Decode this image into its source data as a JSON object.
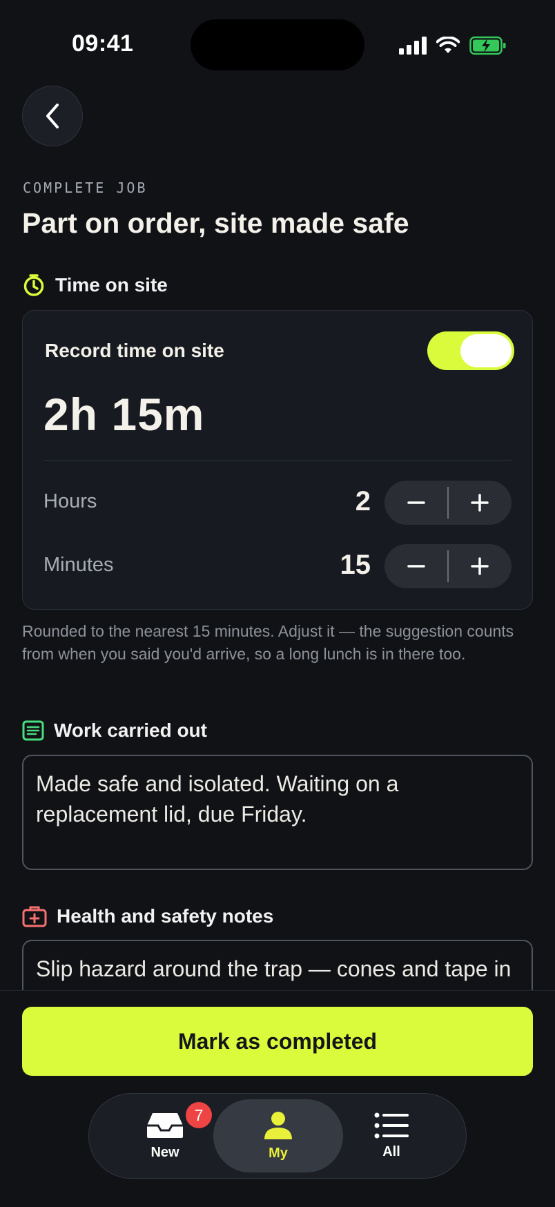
{
  "status_bar": {
    "time": "09:41"
  },
  "header": {
    "back_icon": "chevron-left-icon",
    "eyebrow": "COMPLETE JOB",
    "title": "Part on order, site made safe"
  },
  "time_on_site": {
    "section_label": "Time on site",
    "icon": "timer-icon",
    "record_label": "Record time on site",
    "record_enabled": true,
    "total": "2h 15m",
    "hours": {
      "label": "Hours",
      "value": "2"
    },
    "minutes": {
      "label": "Minutes",
      "value": "15"
    },
    "helper": "Rounded to the nearest 15 minutes. Adjust it — the suggestion counts from when you said you'd arrive, so a long lunch is in there too."
  },
  "work_carried_out": {
    "section_label": "Work carried out",
    "icon": "notes-icon",
    "value": "Made safe and isolated. Waiting on a replacement lid, due Friday."
  },
  "health_safety": {
    "section_label": "Health and safety notes",
    "icon": "first-aid-icon",
    "value": "Slip hazard around the trap — cones and tape in place."
  },
  "primary_action": {
    "label": "Mark as completed"
  },
  "tab_bar": {
    "tabs": [
      {
        "label": "New",
        "icon": "inbox-icon",
        "badge": "7"
      },
      {
        "label": "My",
        "icon": "person-icon",
        "active": true
      },
      {
        "label": "All",
        "icon": "list-icon"
      }
    ]
  },
  "colors": {
    "background": "#101216",
    "accent": "#d9fb3b",
    "badge": "#ef4444",
    "timer_icon": "#d9fb3b",
    "notes_icon": "#4ade80",
    "first_aid_icon": "#f87171"
  }
}
